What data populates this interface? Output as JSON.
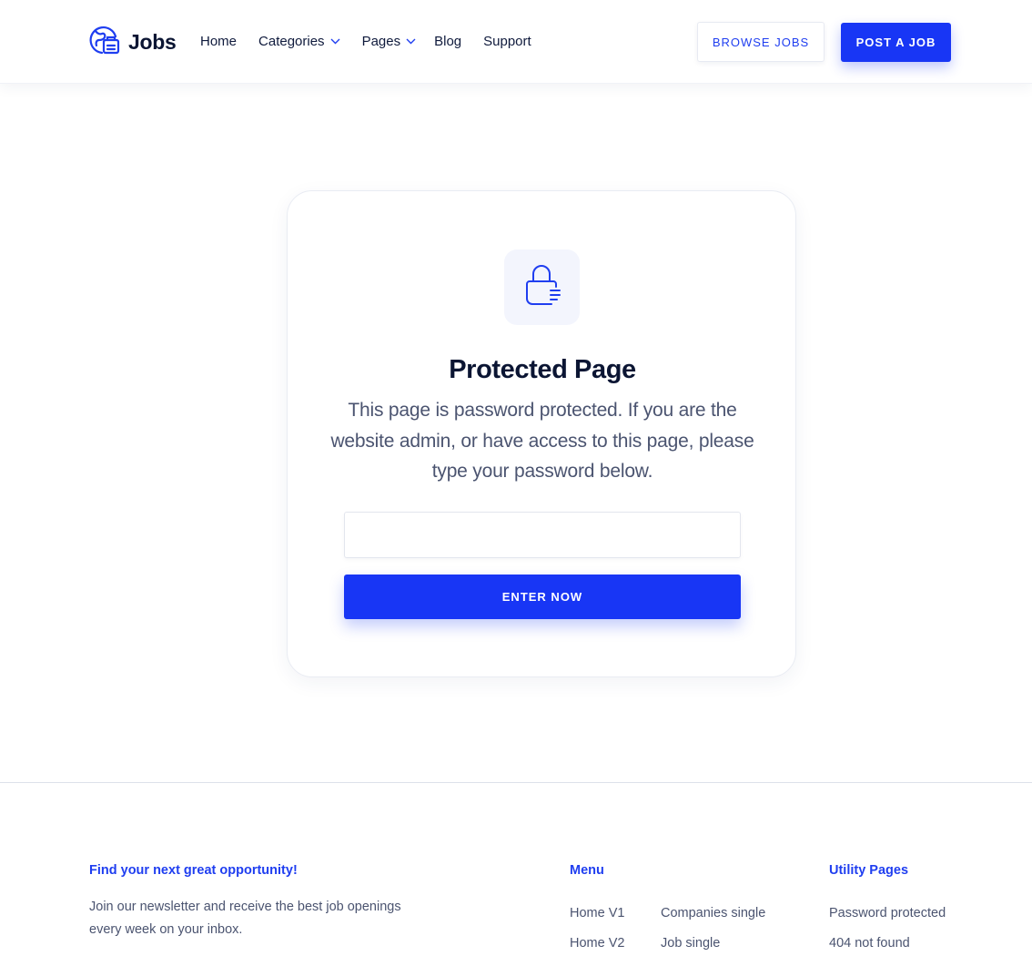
{
  "header": {
    "logo_text": "Jobs",
    "nav": {
      "home": "Home",
      "categories": "Categories",
      "pages": "Pages",
      "blog": "Blog",
      "support": "Support"
    },
    "browse_jobs": "BROWSE JOBS",
    "post_job": "POST A JOB"
  },
  "card": {
    "icon": "lock-icon",
    "title": "Protected Page",
    "description": "This page is password protected. If you are the website admin, or have access to this page, please type your password below.",
    "password_value": "",
    "enter_button": "ENTER NOW"
  },
  "footer": {
    "newsletter_heading": "Find your next great opportunity!",
    "newsletter_text": "Join our newsletter and receive the best job openings every week on your inbox.",
    "menu_heading": "Menu",
    "menu_col1": [
      "Home V1",
      "Home V2"
    ],
    "menu_col2": [
      "Companies single",
      "Job single"
    ],
    "utility_heading": "Utility Pages",
    "utility_links": [
      "Password protected",
      "404 not found"
    ]
  },
  "colors": {
    "primary": "#1836f5",
    "heading": "#0b1533",
    "body_text": "#4b5470"
  }
}
